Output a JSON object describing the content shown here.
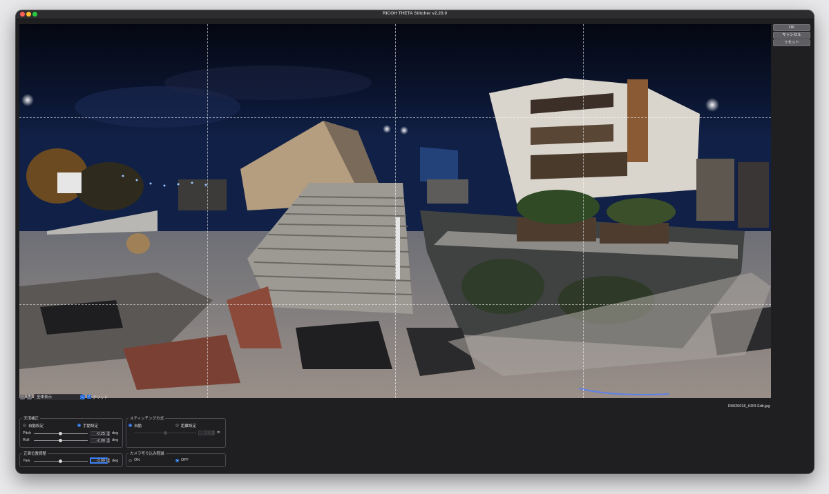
{
  "window": {
    "title": "RICOH THETA Stitcher v2.20.0"
  },
  "side_buttons": {
    "ok": "OK",
    "cancel": "キャンセル",
    "reset": "リセット"
  },
  "toolbar": {
    "zoom_out": "−",
    "zoom_in": "+",
    "view_mode": "全体表示",
    "grid_checked": true,
    "grid_label": "グリッド",
    "filename": "R0020018_HDR-Edit.jpg"
  },
  "zenith": {
    "title": "天頂補正",
    "auto_label": "自動設定",
    "manual_label": "手動設定",
    "selected": "manual",
    "pitch_label": "Pitch",
    "pitch_value": "-0.25",
    "roll_label": "Roll",
    "roll_value": "-2.00",
    "unit": "deg"
  },
  "stitching": {
    "title": "スティッチング方式",
    "auto_label": "自動",
    "distance_label": "距離設定",
    "selected": "auto",
    "distance_value": "1.0",
    "unit": "m"
  },
  "front": {
    "title": "正面位置調整",
    "yaw_label": "Yaw",
    "yaw_value": "-3.00",
    "unit": "deg"
  },
  "camera_reflection": {
    "title": "カメラ写り込み軽減",
    "on_label": "ON",
    "off_label": "OFF",
    "selected": "off"
  }
}
